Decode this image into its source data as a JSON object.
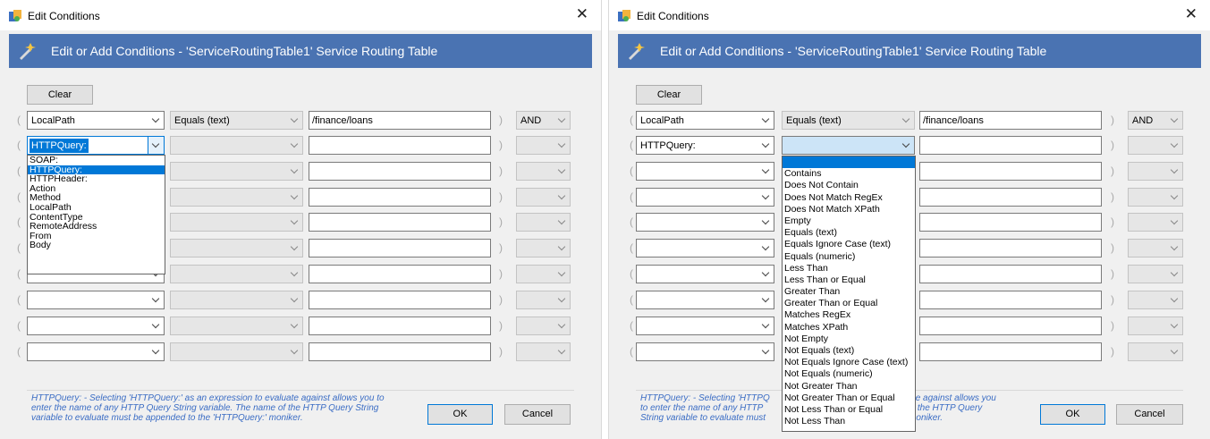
{
  "dialog": {
    "title": "Edit Conditions",
    "banner": "Edit or Add Conditions - 'ServiceRoutingTable1' Service Routing Table",
    "clear_label": "Clear",
    "ok_label": "OK",
    "cancel_label": "Cancel",
    "help_text": "HTTPQuery: - Selecting 'HTTPQuery:' as an expression to evaluate against allows you to enter the name of any HTTP Query String variable. The name of the HTTP Query String variable to evaluate must be appended to the 'HTTPQuery:' moniker.",
    "close_icon": "close-icon",
    "accent_color": "#4a73b2"
  },
  "left": {
    "row1": {
      "open_paren": "(",
      "field": "LocalPath",
      "operator": "Equals (text)",
      "value": "/finance/loans",
      "close_paren": ")",
      "logic": "AND"
    },
    "row2": {
      "field": "HTTPQuery:"
    },
    "field_options": [
      "SOAP:",
      "HTTPQuery:",
      "HTTPHeader:",
      "Action",
      "Method",
      "LocalPath",
      "ContentType",
      "RemoteAddress",
      "From",
      "Body"
    ],
    "selected_option": "HTTPQuery:"
  },
  "right": {
    "row1": {
      "open_paren": "(",
      "field": "LocalPath",
      "operator": "Equals (text)",
      "value": "/finance/loans",
      "close_paren": ")",
      "logic": "AND"
    },
    "row2": {
      "field": "HTTPQuery:"
    },
    "operator_options": [
      "",
      "Contains",
      "Does Not Contain",
      "Does Not Match RegEx",
      "Does Not Match XPath",
      "Empty",
      "Equals (text)",
      "Equals Ignore Case (text)",
      "Equals (numeric)",
      "Less Than",
      "Less Than or Equal",
      "Greater Than",
      "Greater Than or Equal",
      "Matches RegEx",
      "Matches XPath",
      "Not Empty",
      "Not Equals (text)",
      "Not Equals Ignore Case (text)",
      "Not Equals (numeric)",
      "Not Greater Than",
      "Not Greater Than or Equal",
      "Not Less Than or Equal",
      "Not Less Than"
    ],
    "help_visible_line1": "HTTPQuery: - Selecting 'HTTPQ",
    "help_visible_line1b": "e against allows you",
    "help_visible_line2": "to enter the name of any HTTP",
    "help_visible_line2b": "f the HTTP Query",
    "help_visible_line3": "String variable to evaluate must",
    "help_visible_line3b": "moniker."
  }
}
